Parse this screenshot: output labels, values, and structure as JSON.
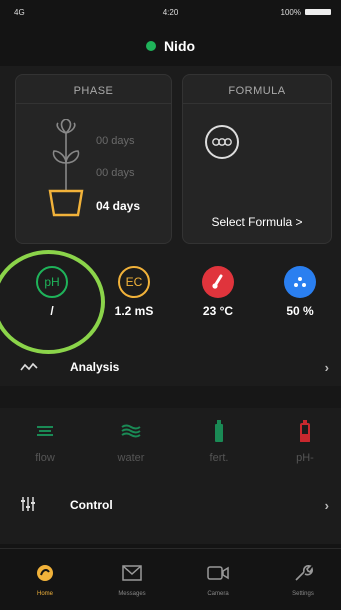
{
  "status": {
    "signal": "4G",
    "time": "4:20",
    "battery": "100%"
  },
  "device": {
    "name": "Nido",
    "status_color": "#1fb35a"
  },
  "phase": {
    "title": "PHASE",
    "rows": [
      {
        "text": "00 days"
      },
      {
        "text": "00 days"
      },
      {
        "text": "04 days"
      }
    ]
  },
  "formula": {
    "title": "FORMULA",
    "select_label": "Select Formula >"
  },
  "sensors": [
    {
      "icon": "pH",
      "value": "/",
      "color": "#1fb35a"
    },
    {
      "icon": "EC",
      "value": "1.2 mS",
      "color": "#f1b23a"
    },
    {
      "icon": "thermometer-icon",
      "value": "23 °C",
      "color": "#e0343c"
    },
    {
      "icon": "humidity-icon",
      "value": "50 %",
      "color": "#2a7ff0"
    }
  ],
  "analysis": {
    "label": "Analysis"
  },
  "controls": [
    {
      "label": "flow",
      "icon": "flow-icon",
      "color": "#1a8a55"
    },
    {
      "label": "water",
      "icon": "water-icon",
      "color": "#1a8a55"
    },
    {
      "label": "fert.",
      "icon": "fert-bottle-icon",
      "color": "#1a8a55"
    },
    {
      "label": "pH-",
      "icon": "ph-bottle-icon",
      "color": "#c9282e"
    }
  ],
  "control": {
    "label": "Control"
  },
  "tabs": [
    {
      "label": "Home",
      "active": true
    },
    {
      "label": "Messages",
      "active": false
    },
    {
      "label": "Camera",
      "active": false
    },
    {
      "label": "Settings",
      "active": false
    }
  ],
  "highlight_color": "#8bd44a"
}
